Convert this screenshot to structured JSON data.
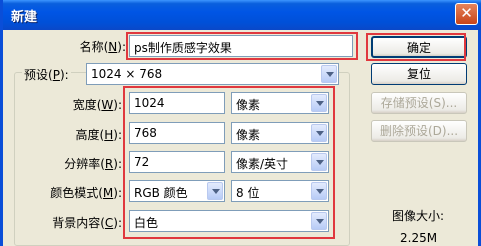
{
  "window": {
    "title": "新建",
    "close_glyph": "✕"
  },
  "name": {
    "label_pre": "名称(",
    "label_key": "N",
    "label_post": "):",
    "value": "ps制作质感字效果"
  },
  "preset": {
    "label_pre": "预设(",
    "label_key": "P",
    "label_post": "):",
    "value": "1024 × 768"
  },
  "width": {
    "label_pre": "宽度(",
    "label_key": "W",
    "label_post": "):",
    "value": "1024",
    "unit": "像素"
  },
  "height": {
    "label_pre": "高度(",
    "label_key": "H",
    "label_post": "):",
    "value": "768",
    "unit": "像素"
  },
  "resolution": {
    "label_pre": "分辨率(",
    "label_key": "R",
    "label_post": "):",
    "value": "72",
    "unit": "像素/英寸"
  },
  "color_mode": {
    "label_pre": "颜色模式(",
    "label_key": "M",
    "label_post": "):",
    "value": "RGB 颜色",
    "depth": "8 位"
  },
  "background": {
    "label_pre": "背景内容(",
    "label_key": "C",
    "label_post": "):",
    "value": "白色"
  },
  "buttons": {
    "ok": "确定",
    "reset": "复位",
    "save_preset": "存储预设(S)...",
    "delete_preset": "删除预设(D)..."
  },
  "image_size": {
    "label": "图像大小:",
    "value": "2.25M"
  },
  "colors": {
    "title_bar": "#0055e5",
    "highlight": "#e0383e",
    "dialog_bg": "#ece9d8"
  }
}
